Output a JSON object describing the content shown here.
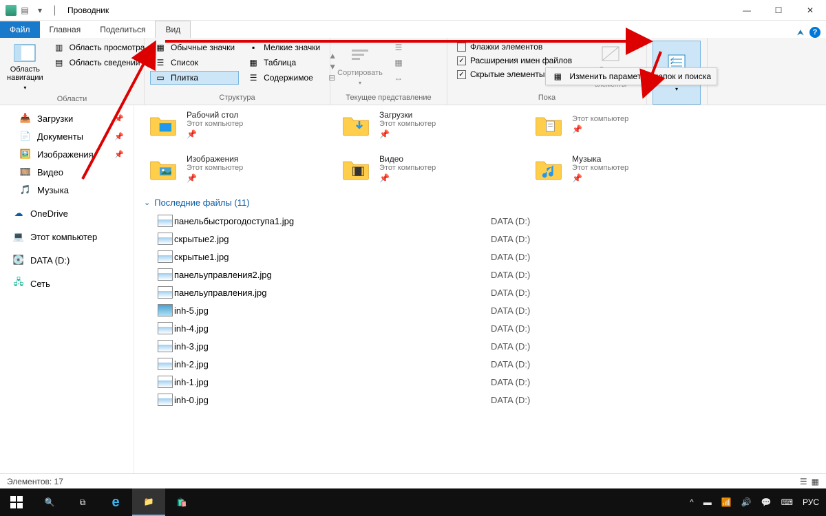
{
  "window": {
    "title": "Проводник",
    "tabs": {
      "file": "Файл",
      "home": "Главная",
      "share": "Поделиться",
      "view": "Вид"
    }
  },
  "ribbon": {
    "panes": {
      "nav_pane": "Область навигации",
      "preview": "Область просмотра",
      "details_pane": "Область сведений",
      "panes_label": "Области"
    },
    "layout": {
      "normal_icons": "Обычные значки",
      "small_icons": "Мелкие значки",
      "list": "Список",
      "table": "Таблица",
      "tile": "Плитка",
      "content": "Содержимое",
      "layout_label": "Структура"
    },
    "current_view": {
      "sort": "Сортировать",
      "label": "Текущее представление"
    },
    "show_hide": {
      "checkboxes": "Флажки элементов",
      "extensions": "Расширения имен файлов",
      "hidden": "Скрытые элементы",
      "hide_selected": "Скрыть выбранные элементы",
      "label": "Пока"
    },
    "options": {
      "params": "Параметры",
      "menu": "Изменить параметры папок и поиска"
    }
  },
  "sidebar": {
    "downloads": "Загрузки",
    "documents": "Документы",
    "pictures": "Изображения",
    "videos": "Видео",
    "music": "Музыка",
    "onedrive": "OneDrive",
    "thispc": "Этот компьютер",
    "datad": "DATA (D:)",
    "network": "Сеть"
  },
  "tiles": [
    {
      "name": "Рабочий стол",
      "sub": "Этот компьютер",
      "icon": "desktop"
    },
    {
      "name": "Загрузки",
      "sub": "Этот компьютер",
      "icon": "downloads"
    },
    {
      "name": "",
      "sub": "Этот компьютер",
      "icon": "documents"
    },
    {
      "name": "Изображения",
      "sub": "Этот компьютер",
      "icon": "pictures"
    },
    {
      "name": "Видео",
      "sub": "Этот компьютер",
      "icon": "videos"
    },
    {
      "name": "Музыка",
      "sub": "Этот компьютер",
      "icon": "music"
    }
  ],
  "section": {
    "recent": "Последние файлы (11)"
  },
  "files": [
    {
      "name": "панельбыстрогодоступа1.jpg",
      "loc": "DATA (D:)",
      "type": "img"
    },
    {
      "name": "скрытые2.jpg",
      "loc": "DATA (D:)",
      "type": "img"
    },
    {
      "name": "скрытые1.jpg",
      "loc": "DATA (D:)",
      "type": "img"
    },
    {
      "name": "панельуправления2.jpg",
      "loc": "DATA (D:)",
      "type": "img"
    },
    {
      "name": "панельуправления.jpg",
      "loc": "DATA (D:)",
      "type": "img"
    },
    {
      "name": "inh-5.jpg",
      "loc": "DATA (D:)",
      "type": "photo"
    },
    {
      "name": "inh-4.jpg",
      "loc": "DATA (D:)",
      "type": "img"
    },
    {
      "name": "inh-3.jpg",
      "loc": "DATA (D:)",
      "type": "img"
    },
    {
      "name": "inh-2.jpg",
      "loc": "DATA (D:)",
      "type": "img"
    },
    {
      "name": "inh-1.jpg",
      "loc": "DATA (D:)",
      "type": "img"
    },
    {
      "name": "inh-0.jpg",
      "loc": "DATA (D:)",
      "type": "img"
    }
  ],
  "status": {
    "items": "Элементов: 17"
  },
  "taskbar": {
    "lang": "РУС"
  }
}
